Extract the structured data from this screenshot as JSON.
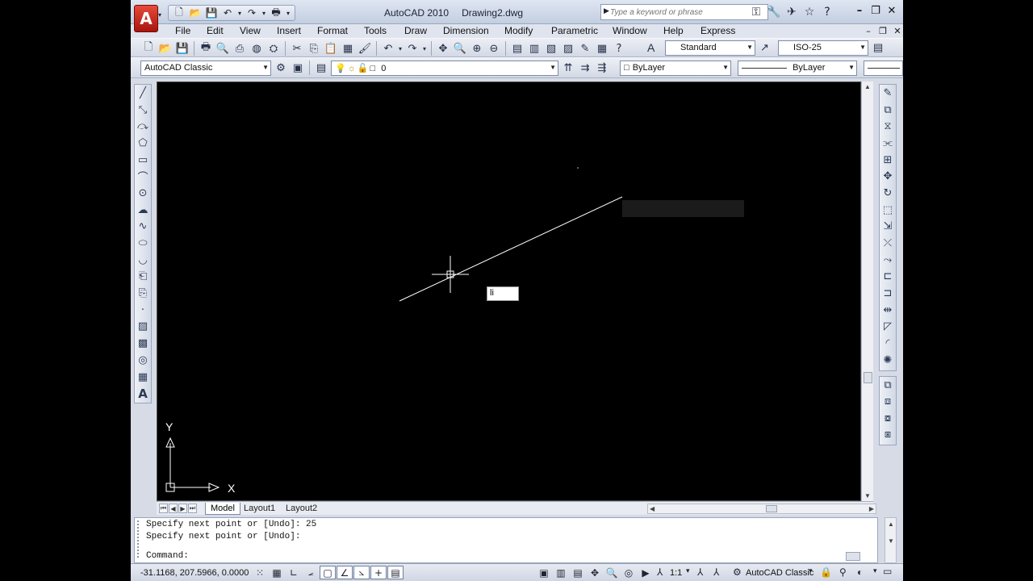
{
  "window": {
    "app_name": "AutoCAD 2010",
    "file_name": "Drawing2.dwg",
    "logo_letter": "A",
    "controls": [
      "minimize-icon",
      "restore-icon",
      "close-icon"
    ]
  },
  "search": {
    "placeholder": "Type a keyword or phrase"
  },
  "menu": [
    "File",
    "Edit",
    "View",
    "Insert",
    "Format",
    "Tools",
    "Draw",
    "Dimension",
    "Modify",
    "Parametric",
    "Window",
    "Help",
    "Express"
  ],
  "toolbar": {
    "text_style": "Standard",
    "dim_style": "ISO-25",
    "workspace": "AutoCAD Classic",
    "layer": "0",
    "color": "ByLayer",
    "linetype": "ByLayer"
  },
  "tabs": [
    "Model",
    "Layout1",
    "Layout2"
  ],
  "command": {
    "history": [
      "Specify next point or [Undo]: 25",
      "Specify next point or [Undo]:"
    ],
    "prompt": "Command:"
  },
  "dynamic_input": {
    "value": "li"
  },
  "status": {
    "coordinates": "-31.1168, 207.5966, 0.0000",
    "annotation_scale": "1:1",
    "workspace": "AutoCAD Classic"
  },
  "ucs": {
    "x_label": "X",
    "y_label": "Y"
  },
  "colors": {
    "canvas": "#000000",
    "chrome": "#d6dbe6",
    "logo": "#c8231a",
    "line": "#ffffff"
  }
}
